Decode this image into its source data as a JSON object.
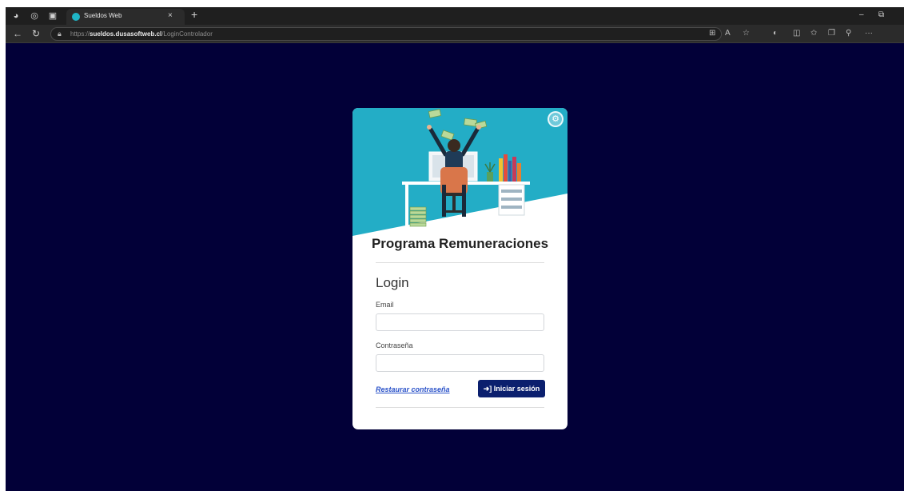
{
  "browser": {
    "tab_title": "Sueldos Web",
    "tab_close": "×",
    "new_tab": "+",
    "url_scheme": "https://",
    "url_host": "sueldos.dusasoftweb.cl",
    "url_path": "/LoginControlador",
    "window_minimize": "–",
    "window_restore": "⧉",
    "more_menu": "···"
  },
  "login_card": {
    "app_title": "Programa Remuneraciones",
    "heading": "Login",
    "email_label": "Email",
    "email_value": "",
    "password_label": "Contraseña",
    "password_value": "",
    "restore_link": "Restaurar contraseña",
    "submit_label": "Iniciar sesión",
    "submit_icon": "sign-in-icon",
    "settings_icon": "gear-icon"
  },
  "colors": {
    "page_background": "#020038",
    "hero_teal": "#23adc6",
    "button_navy": "#0b1f6e",
    "link_blue": "#2a52c9"
  }
}
